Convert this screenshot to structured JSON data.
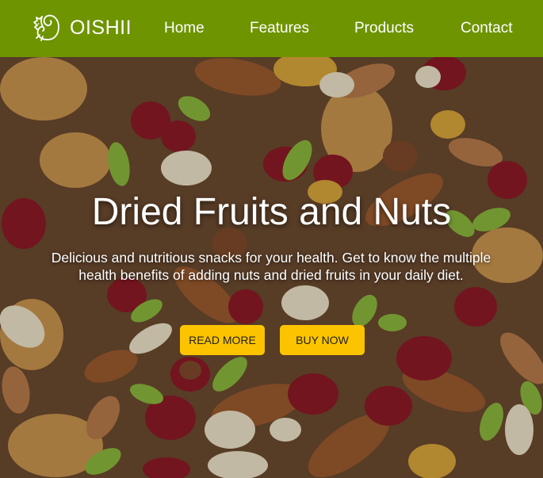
{
  "brand": {
    "name": "OISHII",
    "logo_icon": "squirrel-icon"
  },
  "nav": {
    "items": [
      {
        "label": "Home"
      },
      {
        "label": "Features"
      },
      {
        "label": "Products"
      },
      {
        "label": "Contact"
      }
    ]
  },
  "hero": {
    "title": "Dried Fruits and Nuts",
    "description": "Delicious and nutritious snacks for your health. Get to know the multiple health benefits of adding nuts and dried fruits in your daily diet.",
    "buttons": {
      "read_more": "READ MORE",
      "buy_now": "BUY NOW"
    }
  },
  "colors": {
    "nav_bg": "#6e9400",
    "button_bg": "#fcc300",
    "text": "#ffffff"
  }
}
